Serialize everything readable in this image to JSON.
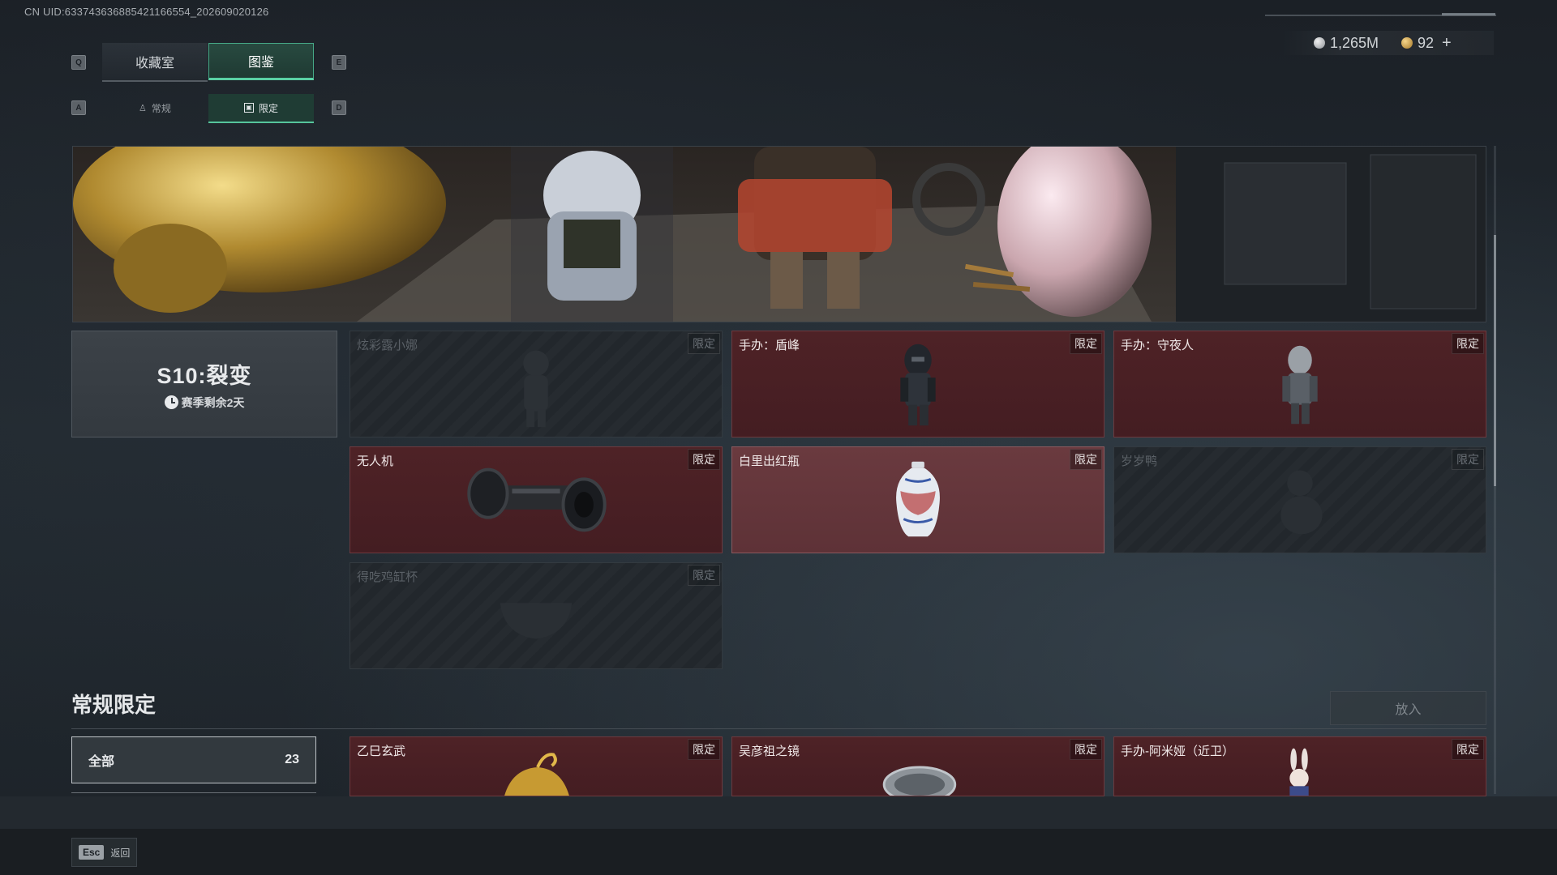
{
  "uid": "CN UID:633743636885421166554_202609020126",
  "currency": {
    "silver": {
      "icon": "silver-coin-icon",
      "value": "1,265M"
    },
    "gold": {
      "icon": "gold-coin-icon",
      "value": "92"
    },
    "add_label": "+"
  },
  "tabs": {
    "left_key": "Q",
    "right_key": "E",
    "items": [
      {
        "label": "收藏室",
        "active": false
      },
      {
        "label": "图鉴",
        "active": true
      }
    ]
  },
  "subtabs": {
    "left_key": "A",
    "right_key": "D",
    "items": [
      {
        "label": "常规",
        "active": false
      },
      {
        "label": "限定",
        "active": true
      }
    ]
  },
  "season": {
    "title": "S10:裂变",
    "remaining": "赛季剩余2天"
  },
  "season_cards": [
    {
      "name": "炫彩露小娜",
      "badge": "限定",
      "owned": false
    },
    {
      "name": "手办：盾峰",
      "badge": "限定",
      "owned": true
    },
    {
      "name": "手办：守夜人",
      "badge": "限定",
      "owned": true
    },
    {
      "name": "无人机",
      "badge": "限定",
      "owned": true
    },
    {
      "name": "白里出红瓶",
      "badge": "限定",
      "owned": true
    },
    {
      "name": "岁岁鸭",
      "badge": "限定",
      "owned": false
    },
    {
      "name": "得吃鸡缸杯",
      "badge": "限定",
      "owned": false
    }
  ],
  "regular_section": {
    "title": "常规限定",
    "put_button": "放入",
    "filter": {
      "label": "全部",
      "count": "23"
    },
    "cards": [
      {
        "name": "乙巳玄武",
        "badge": "限定"
      },
      {
        "name": "吴彦祖之镜",
        "badge": "限定"
      },
      {
        "name": "手办-阿米娅（近卫）",
        "badge": "限定"
      }
    ]
  },
  "footer": {
    "key": "Esc",
    "label": "返回"
  }
}
